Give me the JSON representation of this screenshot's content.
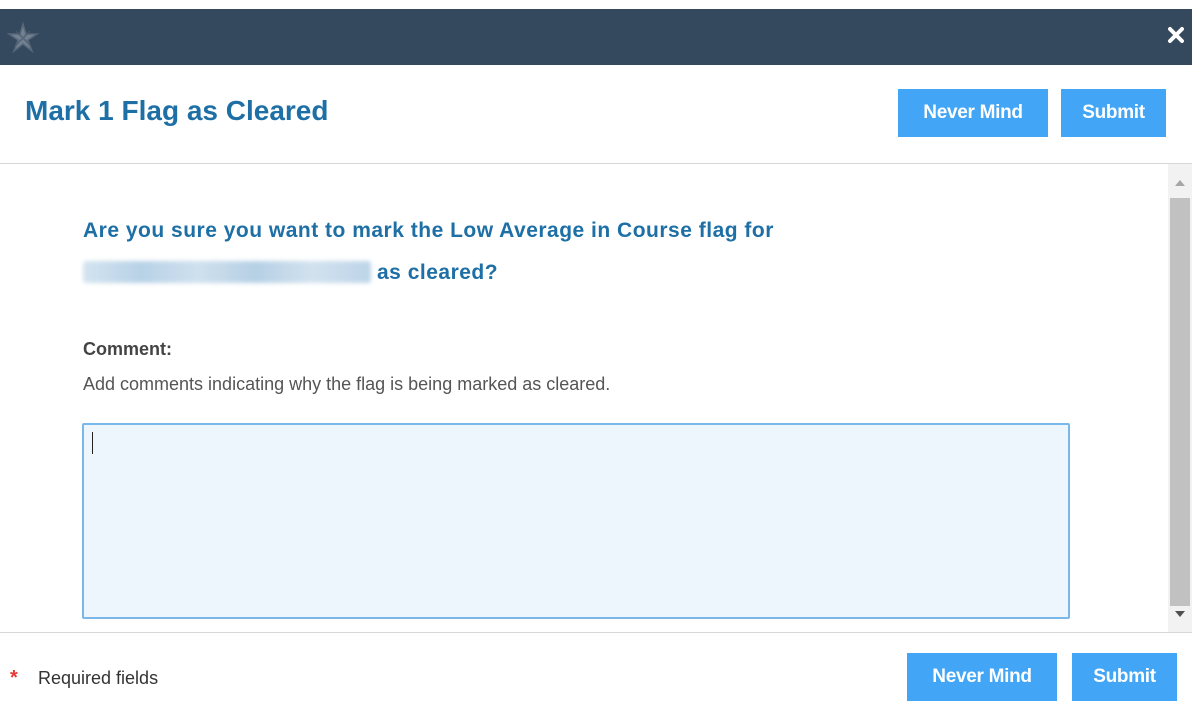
{
  "dialog": {
    "title": "Mark 1 Flag as Cleared",
    "never_mind_label": "Never Mind",
    "submit_label": "Submit",
    "question_prefix": "Are you sure you want to mark the Low Average in Course flag for",
    "question_suffix": "as cleared?",
    "comment_label": "Comment:",
    "comment_help": "Add comments indicating why the flag is being marked as cleared.",
    "comment_value": "",
    "required_star": "*",
    "required_text": "Required fields"
  },
  "icons": {
    "logo": "star-logo-icon",
    "close": "close-icon",
    "scroll_up": "triangle-up-icon",
    "scroll_down": "triangle-down-icon"
  },
  "colors": {
    "topbar": "#34495e",
    "title": "#1d6fa5",
    "button": "#42a5f5",
    "required": "#e53935",
    "comment_bg": "#eef6fd",
    "comment_border": "#7ab8ea"
  }
}
